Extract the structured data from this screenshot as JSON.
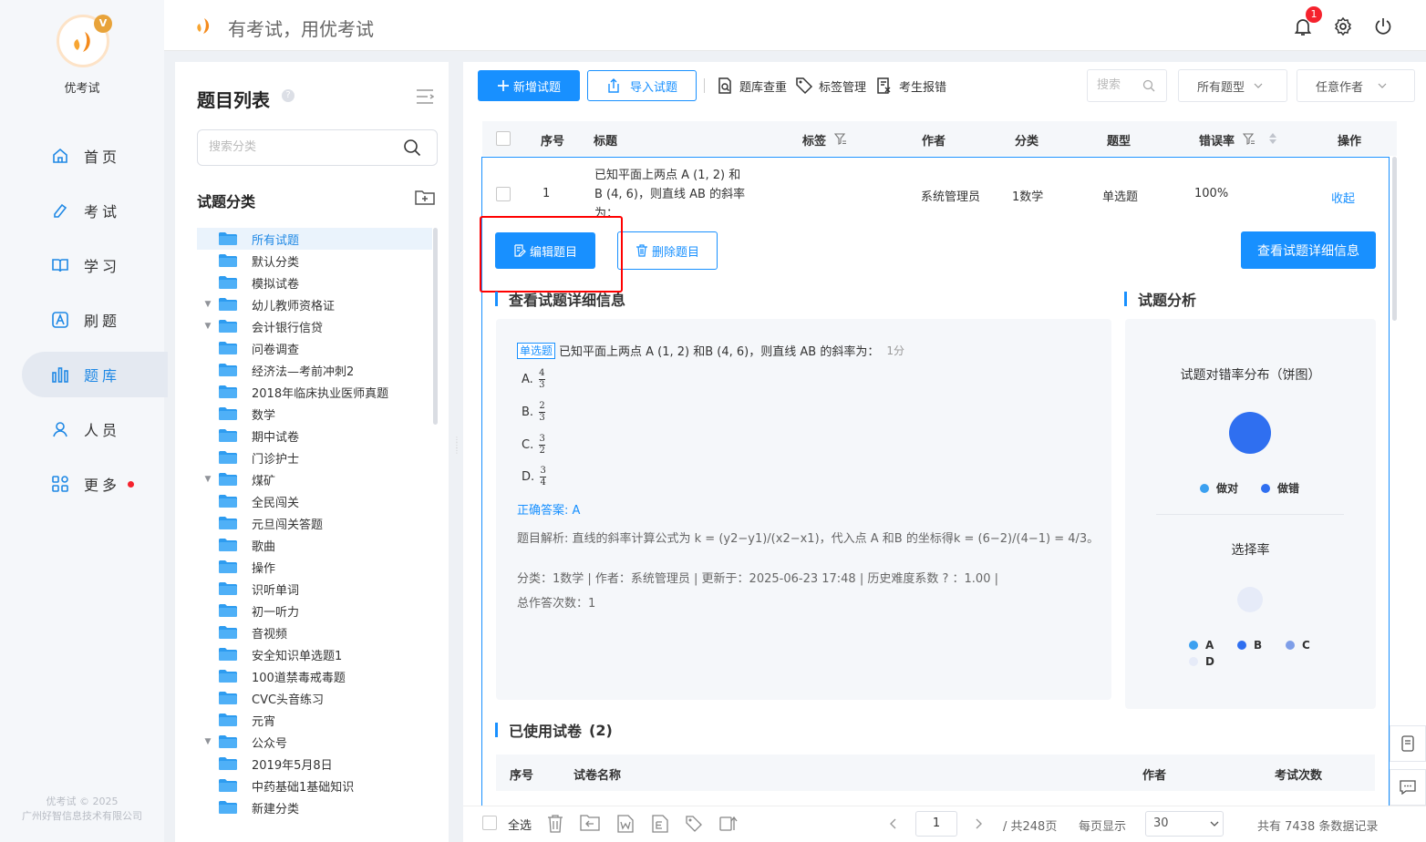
{
  "brand": {
    "name": "优考试",
    "crown": "V",
    "slogan": "有考试，用优考试",
    "copyright_line1": "优考试 © 2025",
    "copyright_line2": "广州好智信息技术有限公司"
  },
  "nav": [
    {
      "label": "首页",
      "icon": "home-icon"
    },
    {
      "label": "考试",
      "icon": "pen-icon"
    },
    {
      "label": "学习",
      "icon": "book-icon"
    },
    {
      "label": "刷题",
      "icon": "a-box-icon"
    },
    {
      "label": "题库",
      "icon": "bar-chart-icon",
      "active": true
    },
    {
      "label": "人员",
      "icon": "user-icon"
    },
    {
      "label": "更多",
      "icon": "grid-icon",
      "dot": true
    }
  ],
  "header": {
    "notification_count": "1"
  },
  "left_panel": {
    "title": "题目列表",
    "help": "?",
    "search_placeholder": "搜索分类",
    "category_title": "试题分类",
    "categories": [
      {
        "label": "所有试题",
        "selected": true,
        "arrow": false
      },
      {
        "label": "默认分类",
        "arrow": false
      },
      {
        "label": "模拟试卷",
        "arrow": false
      },
      {
        "label": "幼儿教师资格证",
        "arrow": true
      },
      {
        "label": "会计银行信贷",
        "arrow": true
      },
      {
        "label": "问卷调查",
        "arrow": false
      },
      {
        "label": "经济法—考前冲刺2",
        "arrow": false
      },
      {
        "label": "2018年临床执业医师真题",
        "arrow": false
      },
      {
        "label": "数学",
        "arrow": false
      },
      {
        "label": "期中试卷",
        "arrow": false
      },
      {
        "label": "门诊护士",
        "arrow": false
      },
      {
        "label": "煤矿",
        "arrow": true
      },
      {
        "label": "全民闯关",
        "arrow": false
      },
      {
        "label": "元旦闯关答题",
        "arrow": false
      },
      {
        "label": "歌曲",
        "arrow": false
      },
      {
        "label": "操作",
        "arrow": false
      },
      {
        "label": "识听单词",
        "arrow": false
      },
      {
        "label": "初一听力",
        "arrow": false
      },
      {
        "label": "音视频",
        "arrow": false
      },
      {
        "label": "安全知识单选题1",
        "arrow": false
      },
      {
        "label": "100道禁毒戒毒题",
        "arrow": false
      },
      {
        "label": "CVC头音练习",
        "arrow": false
      },
      {
        "label": "元宵",
        "arrow": false
      },
      {
        "label": "公众号",
        "arrow": true
      },
      {
        "label": "2019年5月8日",
        "arrow": false
      },
      {
        "label": "中药基础1基础知识",
        "arrow": false
      },
      {
        "label": "新建分类",
        "arrow": false
      }
    ]
  },
  "toolbar": {
    "add": "新增试题",
    "import": "导入试题",
    "dedupe": "题库查重",
    "tags": "标签管理",
    "report": "考生报错",
    "search_placeholder": "搜索",
    "type_filter": "所有题型",
    "author_filter": "任意作者"
  },
  "table": {
    "headers": {
      "index": "序号",
      "title": "标题",
      "tags": "标签",
      "author": "作者",
      "category": "分类",
      "type": "题型",
      "error_rate": "错误率",
      "ops": "操作"
    },
    "row": {
      "index": "1",
      "title_line1": "已知平面上两点 A (1, 2) 和",
      "title_line2": "B (4, 6)，则直线 AB 的斜率",
      "title_line3": "为：",
      "author": "系统管理员",
      "category": "1数学",
      "type": "单选题",
      "error_rate": "100%",
      "op": "收起"
    }
  },
  "row_actions": {
    "edit": "编辑题目",
    "delete": "删除题目",
    "view_detail": "查看试题详细信息"
  },
  "detail": {
    "section_title": "查看试题详细信息",
    "type_tag": "单选题",
    "question": "已知平面上两点 A (1, 2) 和B (4, 6)，则直线 AB 的斜率为：",
    "score": "1分",
    "options": [
      {
        "label": "A.",
        "num": "4",
        "den": "3"
      },
      {
        "label": "B.",
        "num": "2",
        "den": "3"
      },
      {
        "label": "C.",
        "num": "3",
        "den": "2"
      },
      {
        "label": "D.",
        "num": "3",
        "den": "4"
      }
    ],
    "answer": "正确答案: A",
    "analysis": "题目解析:   直线的斜率计算公式为 k = (y2−y1)/(x2−x1)，代入点 A 和B 的坐标得k = (6−2)/(4−1) = 4/3。",
    "meta_line1": "分类：1数学 | 作者：系统管理员 | 更新于：2025-06-23 17:48 | 历史难度系数 ? ：1.00 |",
    "meta_line2": "总作答次数：1"
  },
  "analysis_panel": {
    "section_title": "试题分析",
    "pie_title": "试题对错率分布（饼图）",
    "legend_pie": [
      {
        "label": "做对",
        "color": "#3ba0f0"
      },
      {
        "label": "做错",
        "color": "#2f6ff0"
      }
    ],
    "select_title": "选择率",
    "legend_select": [
      {
        "label": "A",
        "color": "#3ba0f0"
      },
      {
        "label": "B",
        "color": "#2f6ff0"
      },
      {
        "label": "C",
        "color": "#7e9ee8"
      },
      {
        "label": "D",
        "color": "#e6ebf8"
      }
    ]
  },
  "used_papers": {
    "title": "已使用试卷",
    "count": "(2)",
    "headers": {
      "index": "序号",
      "name": "试卷名称",
      "author": "作者",
      "exam_count": "考试次数"
    }
  },
  "footer": {
    "select_all": "全选",
    "page": "1",
    "total_pages": "/ 共248页",
    "per_page_label": "每页显示",
    "per_page": "30",
    "total": "共有 7438 条数据记录"
  }
}
